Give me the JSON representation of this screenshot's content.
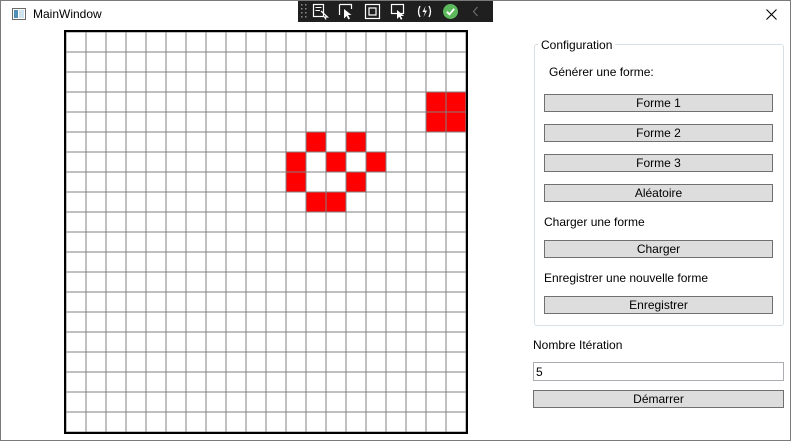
{
  "window": {
    "title": "MainWindow",
    "close_glyph": "✕"
  },
  "debug_toolbar": {
    "icons": [
      "select-element-icon",
      "pointer-select-icon",
      "layout-adorner-icon",
      "track-focus-icon",
      "hot-reload-icon",
      "check-icon",
      "collapse-icon"
    ],
    "check_color": "#5cb85c"
  },
  "grid": {
    "rows": 20,
    "cols": 20,
    "alive_color": "#ff0000",
    "line_color": "#808080",
    "alive_cells": [
      [
        3,
        18
      ],
      [
        3,
        19
      ],
      [
        4,
        18
      ],
      [
        4,
        19
      ],
      [
        5,
        12
      ],
      [
        5,
        14
      ],
      [
        6,
        11
      ],
      [
        6,
        13
      ],
      [
        6,
        15
      ],
      [
        7,
        11
      ],
      [
        7,
        14
      ],
      [
        8,
        12
      ],
      [
        8,
        13
      ]
    ]
  },
  "config": {
    "group_title": "Configuration",
    "generate_label": "Générer une forme:",
    "shape_buttons": [
      "Forme 1",
      "Forme 2",
      "Forme 3",
      "Aléatoire"
    ],
    "load_label": "Charger une forme",
    "load_button": "Charger",
    "save_label": "Enregistrer une nouvelle forme",
    "save_button": "Enregistrer"
  },
  "iterations": {
    "label": "Nombre Itération",
    "value": "5",
    "start_button": "Démarrer"
  }
}
